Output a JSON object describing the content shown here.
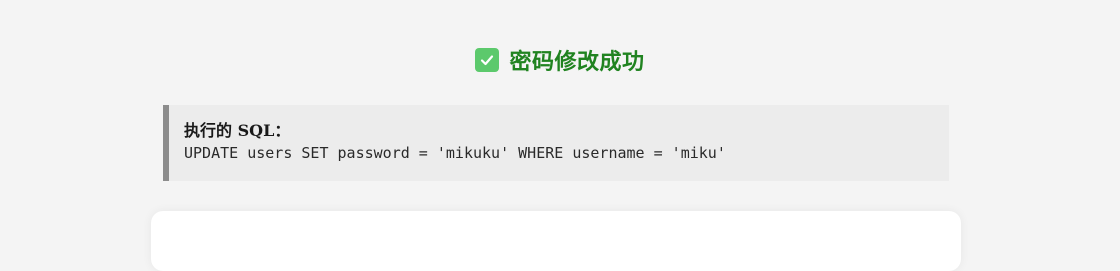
{
  "result": {
    "status_icon": "check-icon",
    "title": "密码修改成功",
    "title_color": "#208320",
    "icon_color": "#5cc96c"
  },
  "sql": {
    "label": "执行的 SQL：",
    "statement": "UPDATE users SET password = 'mikuku' WHERE username = 'miku'"
  }
}
